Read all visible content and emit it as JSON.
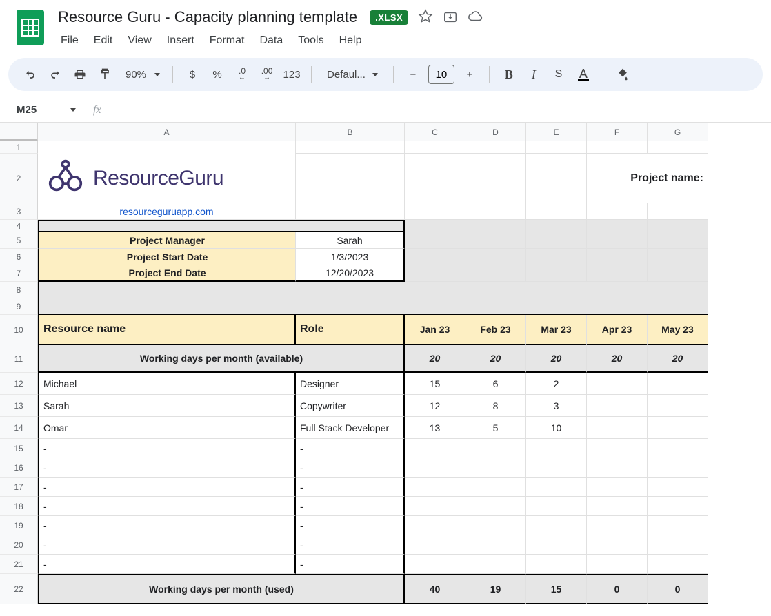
{
  "header": {
    "title": "Resource Guru - Capacity planning template",
    "badge": ".XLSX"
  },
  "menu": [
    "File",
    "Edit",
    "View",
    "Insert",
    "Format",
    "Data",
    "Tools",
    "Help"
  ],
  "toolbar": {
    "zoom": "90%",
    "currency": "$",
    "percent": "%",
    "dec_dec": ".0",
    "dec_inc": ".00",
    "num123": "123",
    "font": "Defaul...",
    "size": "10",
    "bold": "B",
    "italic": "I",
    "strike": "S",
    "textcolor": "A"
  },
  "namebox": "M25",
  "fx_placeholder": "fx",
  "cols": [
    "A",
    "B",
    "C",
    "D",
    "E",
    "F",
    "G"
  ],
  "sheet": {
    "brand": "ResourceGuru",
    "link": "resourceguruapp.com",
    "project_name_label": "Project name:",
    "meta": {
      "pm_label": "Project Manager",
      "pm_value": "Sarah",
      "start_label": "Project Start Date",
      "start_value": "1/3/2023",
      "end_label": "Project End Date",
      "end_value": "12/20/2023"
    },
    "table_hdr": {
      "resource": "Resource name",
      "role": "Role",
      "months": [
        "Jan 23",
        "Feb 23",
        "Mar 23",
        "Apr 23",
        "May 23"
      ]
    },
    "avail_label": "Working days per month (available)",
    "avail": [
      "20",
      "20",
      "20",
      "20",
      "20"
    ],
    "rows": [
      {
        "name": "Michael",
        "role": "Designer",
        "d": [
          "15",
          "6",
          "2",
          "",
          ""
        ]
      },
      {
        "name": "Sarah",
        "role": "Copywriter",
        "d": [
          "12",
          "8",
          "3",
          "",
          ""
        ]
      },
      {
        "name": "Omar",
        "role": "Full Stack Developer",
        "d": [
          "13",
          "5",
          "10",
          "",
          ""
        ]
      },
      {
        "name": "-",
        "role": "-",
        "d": [
          "",
          "",
          "",
          "",
          ""
        ]
      },
      {
        "name": "-",
        "role": "-",
        "d": [
          "",
          "",
          "",
          "",
          ""
        ]
      },
      {
        "name": "-",
        "role": "-",
        "d": [
          "",
          "",
          "",
          "",
          ""
        ]
      },
      {
        "name": "-",
        "role": "-",
        "d": [
          "",
          "",
          "",
          "",
          ""
        ]
      },
      {
        "name": "-",
        "role": "-",
        "d": [
          "",
          "",
          "",
          "",
          ""
        ]
      },
      {
        "name": "-",
        "role": "-",
        "d": [
          "",
          "",
          "",
          "",
          ""
        ]
      },
      {
        "name": "-",
        "role": "-",
        "d": [
          "",
          "",
          "",
          "",
          ""
        ]
      }
    ],
    "used_label": "Working days per month (used)",
    "used": [
      "40",
      "19",
      "15",
      "0",
      "0"
    ]
  }
}
